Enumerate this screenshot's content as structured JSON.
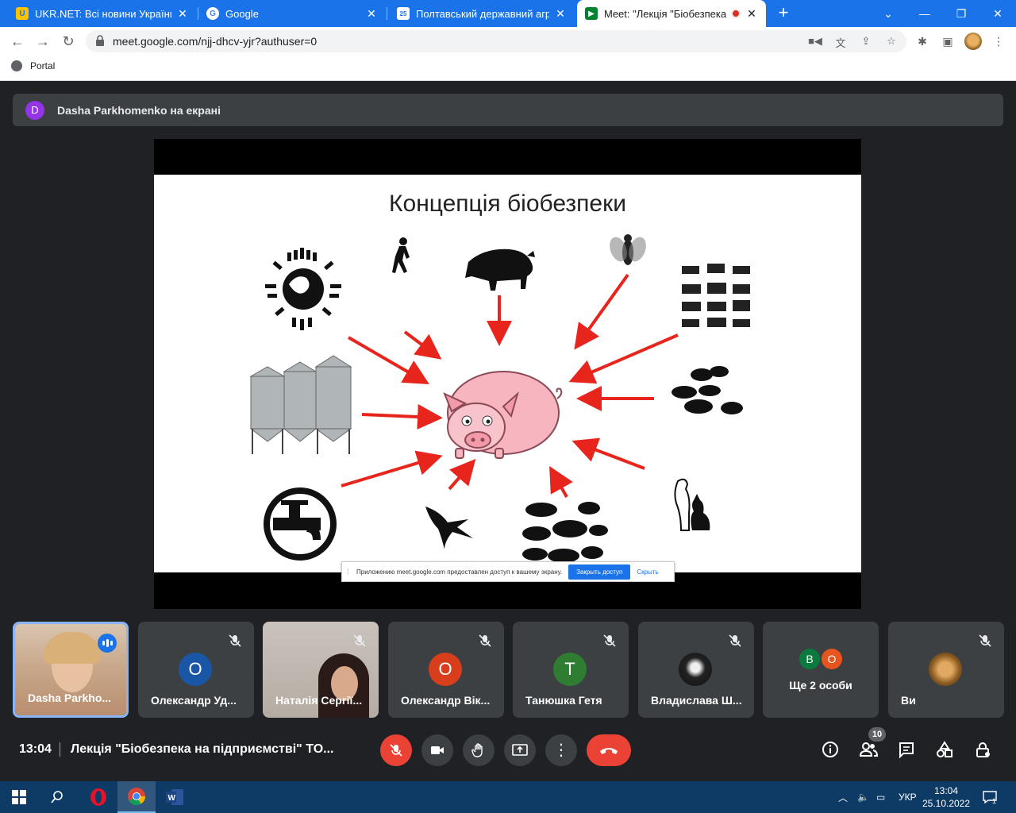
{
  "browser": {
    "tabs": [
      {
        "title": "UKR.NET: Всі новини України, ос",
        "favicon": "ukr-net-icon",
        "color": "#f9c300"
      },
      {
        "title": "Google",
        "favicon": "google-icon",
        "color": "#4285f4"
      },
      {
        "title": "Полтавський державний аграрн",
        "favicon": "calendar-icon",
        "color": "#1a73e8"
      },
      {
        "title": "Meet: \"Лекція \"Біобезпека н",
        "favicon": "meet-icon",
        "color": "#00832d"
      }
    ],
    "url": "meet.google.com/njj-dhcv-yjr?authuser=0",
    "bookmark": "Portal"
  },
  "meet": {
    "presenter_avatar": "D",
    "presenter_text": "Dasha Parkhomenko на екрані",
    "slide_title": "Концепція біобезпеки",
    "share_notice": {
      "message": "Приложению meet.google.com предоставлен доступ к вашему экрану.",
      "stop_label": "Закрыть доступ",
      "hide_label": "Скрыть"
    },
    "participants": [
      {
        "name": "Dasha Parkho...",
        "type": "video",
        "speaking": true
      },
      {
        "name": "Олександр Уд...",
        "type": "avatar",
        "initial": "O",
        "color": "#1a56a6"
      },
      {
        "name": "Наталія Сергії...",
        "type": "video"
      },
      {
        "name": "Олександр Вік...",
        "type": "avatar",
        "initial": "O",
        "color": "#d93e1c"
      },
      {
        "name": "Танюшка Гетя",
        "type": "avatar",
        "initial": "T",
        "color": "#2e7d32"
      },
      {
        "name": "Владислава Ш...",
        "type": "photo"
      },
      {
        "name": "Ще 2 особи",
        "type": "more",
        "initials": [
          "B",
          "O"
        ],
        "colors": [
          "#0b7a3e",
          "#e8541e"
        ]
      },
      {
        "name": "Ви",
        "type": "photo"
      }
    ],
    "clock": "13:04",
    "meeting_title": "Лекція \"Біобезпека на підприємстві\" TO...",
    "participant_count": "10"
  },
  "taskbar": {
    "lang": "УКР",
    "time": "13:04",
    "date": "25.10.2022",
    "notifications": "1"
  }
}
